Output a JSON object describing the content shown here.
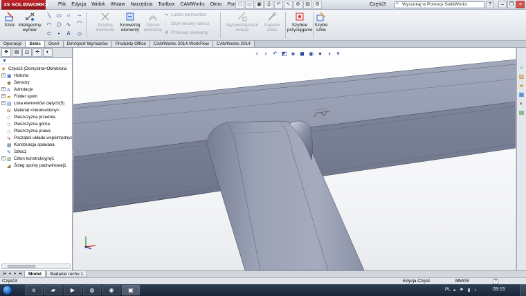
{
  "titlebar": {
    "logo_ds": "3S",
    "logo_text": "SOLIDWORKS",
    "menus": [
      "Plik",
      "Edycja",
      "Widok",
      "Wstaw",
      "Narzędzia",
      "Toolbox",
      "CAMWorks",
      "Okno",
      "Pomoc"
    ],
    "doc_title": "Część3",
    "search_placeholder": "Wyszukaj w Pomocy SolidWorks"
  },
  "commands": {
    "sketch": "Szkic",
    "smart_dim": "Inteligentny wymiar",
    "trim": "Przytnij elementy",
    "convert": "Konwertuj elementy",
    "offset": "Odsuń elementy",
    "mirror": "Lustro elementów",
    "linear_pattern": "Szyk liniowy szkicu",
    "move": "Przenieś elementy",
    "show_relations": "Wyświetlaj/usuń relacje",
    "repair": "Napraw szkic",
    "snaps": "Szybkie przyciąganie",
    "rapid_sketch": "Szybki szkic"
  },
  "tabs": [
    "Operacje",
    "Szkic",
    "Oceń",
    "DimXpert Wymiarów",
    "Produkty Office",
    "CAMWorks 2014-WorkFlow",
    "CAMWorks 2014"
  ],
  "active_tab": "Szkic",
  "tree": [
    {
      "label": "Część3  (Domyślna<Obrobiona",
      "depth": 0,
      "expander": ""
    },
    {
      "label": "Historia",
      "depth": 1,
      "expander": "+"
    },
    {
      "label": "Sensory",
      "depth": 1,
      "expander": ""
    },
    {
      "label": "Adnotacje",
      "depth": 1,
      "expander": "+"
    },
    {
      "label": "Folder spoin",
      "depth": 1,
      "expander": "+"
    },
    {
      "label": "Lista elementów ciętych(5)",
      "depth": 1,
      "expander": "+"
    },
    {
      "label": "Materiał <nieokreślony>",
      "depth": 1,
      "expander": ""
    },
    {
      "label": "Płaszczyzna przednia",
      "depth": 1,
      "expander": ""
    },
    {
      "label": "Płaszczyzna górna",
      "depth": 1,
      "expander": ""
    },
    {
      "label": "Płaszczyzna prawa",
      "depth": 1,
      "expander": ""
    },
    {
      "label": "Początek układu współrzędnych",
      "depth": 1,
      "expander": ""
    },
    {
      "label": "Konstrukcja spawana",
      "depth": 1,
      "expander": ""
    },
    {
      "label": "Szkic1",
      "depth": 1,
      "expander": ""
    },
    {
      "label": "Człon konstrukcyjny1",
      "depth": 1,
      "expander": "+"
    },
    {
      "label": "Ścieg spoiny pachwinowej1",
      "depth": 1,
      "expander": ""
    }
  ],
  "model_tabs": [
    "Model",
    "Badanie ruchu 1"
  ],
  "status": {
    "left": "Część3",
    "mode": "Edycja Część",
    "units": "MMGS",
    "help": "?"
  },
  "taskbar": {
    "lang": "PL",
    "clock": "09:15"
  },
  "colors": {
    "brand_red": "#b3222a",
    "part_gray": "#8a92a6",
    "accent_blue": "#3e76d6"
  }
}
